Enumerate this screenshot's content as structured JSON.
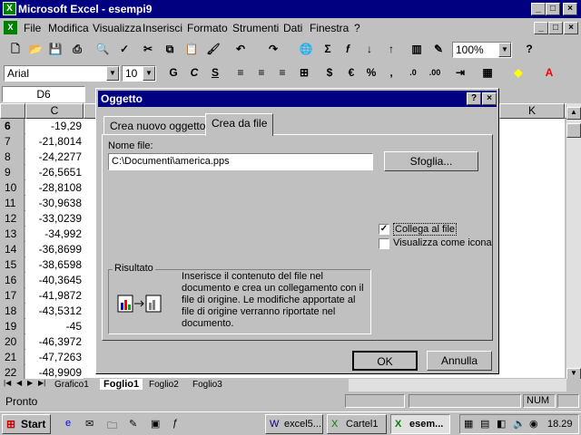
{
  "window": {
    "title": "Microsoft Excel - esempi9"
  },
  "menu": [
    "File",
    "Modifica",
    "Visualizza",
    "Inserisci",
    "Formato",
    "Strumenti",
    "Dati",
    "Finestra",
    "?"
  ],
  "toolbar": {
    "zoom": "100%"
  },
  "format": {
    "font": "Arial",
    "size": "10",
    "bold": "G",
    "italic": "C",
    "underline": "S",
    "euro": "€",
    "percent": "%"
  },
  "namebox": "D6",
  "columns": {
    "c": "C",
    "k": "K"
  },
  "rows": [
    {
      "n": "6",
      "v": "-19,29"
    },
    {
      "n": "7",
      "v": "-21,8014"
    },
    {
      "n": "8",
      "v": "-24,2277"
    },
    {
      "n": "9",
      "v": "-26,5651"
    },
    {
      "n": "10",
      "v": "-28,8108"
    },
    {
      "n": "11",
      "v": "-30,9638"
    },
    {
      "n": "12",
      "v": "-33,0239"
    },
    {
      "n": "13",
      "v": "-34,992"
    },
    {
      "n": "14",
      "v": "-36,8699"
    },
    {
      "n": "15",
      "v": "-38,6598"
    },
    {
      "n": "16",
      "v": "-40,3645"
    },
    {
      "n": "17",
      "v": "-41,9872"
    },
    {
      "n": "18",
      "v": "-43,5312"
    },
    {
      "n": "19",
      "v": "-45"
    },
    {
      "n": "20",
      "v": "-46,3972"
    },
    {
      "n": "21",
      "v": "-47,7263"
    },
    {
      "n": "22",
      "v": "-48,9909"
    }
  ],
  "sheets": [
    "Grafico1",
    "Foglio1",
    "Foglio2",
    "Foglio3"
  ],
  "status": {
    "left": "Pronto",
    "num": "NUM"
  },
  "dialog": {
    "title": "Oggetto",
    "help": "?",
    "tabs": [
      "Crea nuovo oggetto",
      "Crea da file"
    ],
    "filename_label": "Nome file:",
    "filename_value": "C:\\Documenti\\america.pps",
    "browse": "Sfoglia...",
    "link_label": "Collega al file",
    "link_checked": "✓",
    "icon_label": "Visualizza come icona",
    "result_label": "Risultato",
    "result_text": "Inserisce il contenuto del file nel documento e crea un collegamento con il file di origine. Le modifiche apportate al file di origine verranno riportate nel documento.",
    "ok": "OK",
    "cancel": "Annulla"
  },
  "taskbar": {
    "start": "Start",
    "tasks": [
      "excel5...",
      "Cartel1",
      "esem..."
    ],
    "clock": "18.29"
  }
}
